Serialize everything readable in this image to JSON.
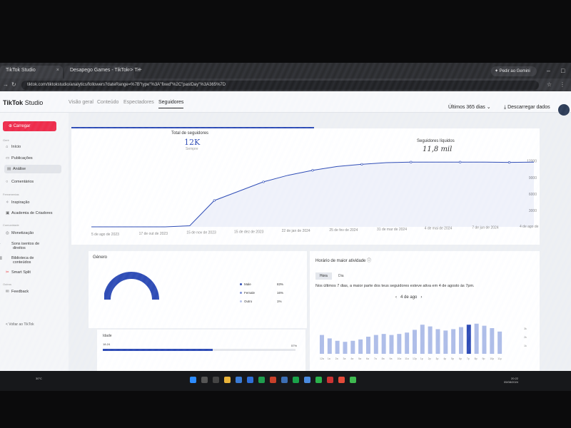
{
  "browser": {
    "tabs": [
      {
        "label": "TikTok Studio"
      },
      {
        "label": "Desapego Games - TikTok > Ti"
      }
    ],
    "new_tab": "+",
    "gemini": "Pedir ao Gemini",
    "url": "tiktok.com/tiktokstudio/analytics/followers?dateRange=%7B\"type\"%3A\"fixed\"%2C\"pastDay\"%3A365%7D"
  },
  "header": {
    "logo": "TikTok",
    "logo_suffix": "Studio",
    "tabs": [
      "Visão geral",
      "Conteúdo",
      "Espectadores",
      "Seguidores"
    ],
    "active_tab": "Seguidores",
    "range": "Últimos 365 dias",
    "download": "Descarregar dados"
  },
  "sidebar": {
    "upload": "Carregar",
    "sections": {
      "gerir": "Gerir",
      "ferramentas": "Ferramentas",
      "comunidade": "Comunidade",
      "outros": "Outros"
    },
    "items": [
      {
        "label": "Início",
        "icon": "home-icon"
      },
      {
        "label": "Publicações",
        "icon": "posts-icon"
      },
      {
        "label": "Análise",
        "icon": "analytics-icon"
      },
      {
        "label": "Comentários",
        "icon": "comments-icon"
      },
      {
        "label": "Inspiração",
        "icon": "inspiration-icon"
      },
      {
        "label": "Academia de Criadores",
        "icon": "academy-icon"
      },
      {
        "label": "Monetização",
        "icon": "monetization-icon"
      },
      {
        "label": "Sons isentos de direitos",
        "icon": "music-icon"
      },
      {
        "label": "Biblioteca de conteúdos",
        "icon": "library-icon"
      },
      {
        "label": "Smart Split",
        "icon": "split-icon"
      },
      {
        "label": "Feedback",
        "icon": "feedback-icon"
      }
    ],
    "back": "< Voltar ao TikTok"
  },
  "overview": {
    "total_label": "Total de seguidores",
    "total_value": "12K",
    "total_sub": "Sempre",
    "net_label": "Seguidores líquidos",
    "net_value": "11,8 mil"
  },
  "chart_data": {
    "type": "line",
    "x_ticks": [
      "5 de ago de 2023",
      "17 de out de 2023",
      "15 de nov de 2023",
      "15 de dez de 2023",
      "22 de jan de 2024",
      "25 de fev de 2024",
      "31 de mar de 2024",
      "4 de mai de 2024",
      "7 de jun de 2024",
      "4 de ago de 2024"
    ],
    "y_ticks": [
      "12000",
      "9000",
      "6000",
      "3000"
    ],
    "ylim": [
      0,
      13000
    ],
    "series": [
      {
        "values": [
          0,
          0,
          0,
          0,
          200,
          4800,
          6500,
          8200,
          9400,
          10300,
          11000,
          11400,
          11700,
          11800,
          11800,
          11800,
          11800,
          11750,
          11800
        ]
      }
    ],
    "highlight_color": "#2d4bb5"
  },
  "gender": {
    "title": "Género",
    "rows": [
      {
        "label": "Male",
        "value": "83%",
        "pct": 83
      },
      {
        "label": "Female",
        "value": "16%",
        "pct": 16
      },
      {
        "label": "Outro",
        "value": "1%",
        "pct": 1
      }
    ]
  },
  "age": {
    "title": "Idade",
    "row_label": "18-24",
    "row_value": "57%",
    "row_pct": 57
  },
  "activity": {
    "title": "Horário de maior atividade",
    "toggle_hour": "Hora",
    "toggle_day": "Dia",
    "description": "Nos últimos 7 dias, a maior parte dos teus seguidores esteve ativa em 4 de agosto às 7pm.",
    "date": "4 de ago",
    "prev": "‹",
    "next": "›",
    "hours": [
      "12a",
      "1a",
      "2a",
      "3a",
      "4a",
      "5a",
      "6a",
      "7a",
      "8a",
      "9a",
      "10a",
      "11a",
      "12p",
      "1p",
      "2p",
      "3p",
      "4p",
      "5p",
      "6p",
      "7p",
      "8p",
      "9p",
      "10p",
      "11p"
    ],
    "values": [
      55,
      45,
      38,
      35,
      38,
      42,
      50,
      55,
      58,
      55,
      58,
      62,
      70,
      85,
      80,
      72,
      68,
      72,
      78,
      85,
      88,
      82,
      75,
      65
    ],
    "highlight_index": 19,
    "y_ticks": [
      "3k",
      "2k",
      "1k"
    ]
  },
  "taskbar": {
    "weather": "30°C",
    "clock_time": "20:22",
    "clock_date": "05/08/2024"
  }
}
